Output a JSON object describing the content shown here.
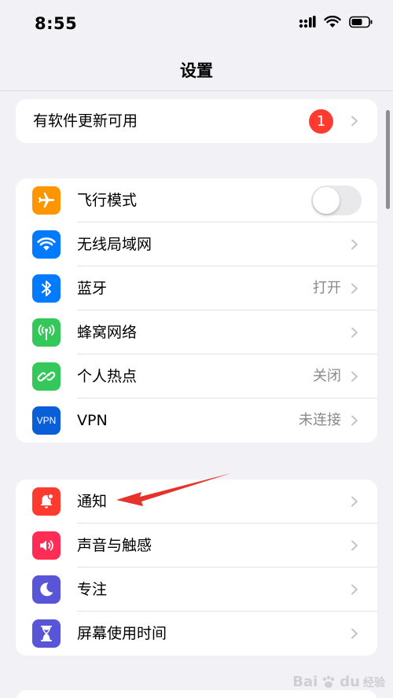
{
  "status_bar": {
    "time": "8:55",
    "icons": [
      "cellular-signal-icon",
      "wifi-icon",
      "battery-icon"
    ]
  },
  "nav": {
    "title": "设置"
  },
  "update_group": {
    "label": "有软件更新可用",
    "badge": "1"
  },
  "connectivity_group": {
    "items": [
      {
        "label": "飞行模式",
        "value": "",
        "icon": "airplane-icon",
        "color": "#ff9500",
        "control": "toggle",
        "toggle_on": false
      },
      {
        "label": "无线局域网",
        "value": "",
        "icon": "wifi-icon",
        "color": "#007aff",
        "control": "chevron"
      },
      {
        "label": "蓝牙",
        "value": "打开",
        "icon": "bluetooth-icon",
        "color": "#007aff",
        "control": "chevron"
      },
      {
        "label": "蜂窝网络",
        "value": "",
        "icon": "cellular-antenna-icon",
        "color": "#34c759",
        "control": "chevron"
      },
      {
        "label": "个人热点",
        "value": "关闭",
        "icon": "hotspot-icon",
        "color": "#34c759",
        "control": "chevron"
      },
      {
        "label": "VPN",
        "value": "未连接",
        "icon": "vpn-icon",
        "icon_text": "VPN",
        "color": "#0a5fd8",
        "control": "chevron"
      }
    ]
  },
  "notification_group": {
    "items": [
      {
        "label": "通知",
        "icon": "notification-bell-icon",
        "color": "#ff3b30"
      },
      {
        "label": "声音与触感",
        "icon": "speaker-icon",
        "color": "#ff2d55"
      },
      {
        "label": "专注",
        "icon": "moon-icon",
        "color": "#5856d6"
      },
      {
        "label": "屏幕使用时间",
        "icon": "hourglass-icon",
        "color": "#5856d6"
      }
    ]
  },
  "annotation": {
    "type": "red-arrow",
    "points_to": "通知",
    "color": "#e8312a"
  },
  "watermark": {
    "brand": "Bai",
    "paw": "du",
    "suffix": "经验"
  }
}
